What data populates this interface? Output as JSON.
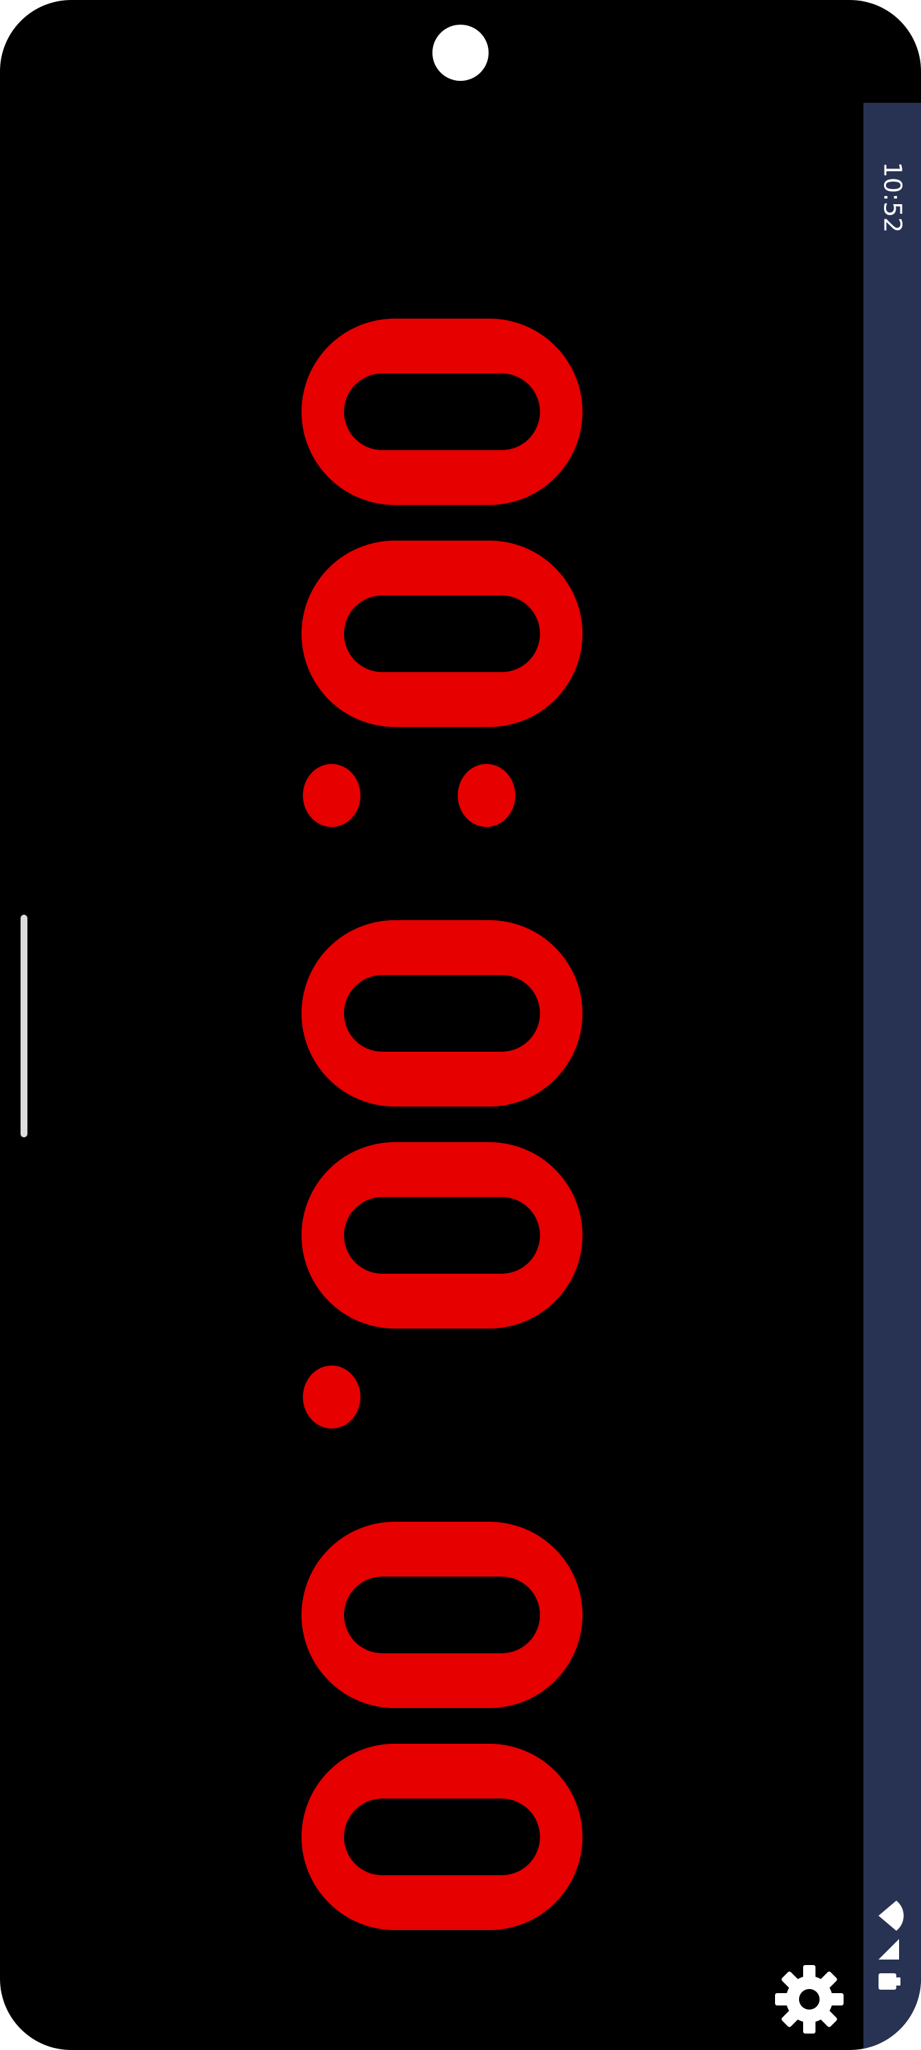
{
  "status_bar": {
    "time": "10:52"
  },
  "timer": {
    "display": "00:00:00",
    "color": "#e60000",
    "background": "#000000",
    "orientation": "rotated-90"
  },
  "theme": {
    "status_bar_color": "#283252",
    "icon_color": "#ffffff"
  },
  "icons": {
    "settings": "gear-icon",
    "wifi": "wifi-icon",
    "signal": "signal-icon",
    "battery": "battery-icon"
  }
}
